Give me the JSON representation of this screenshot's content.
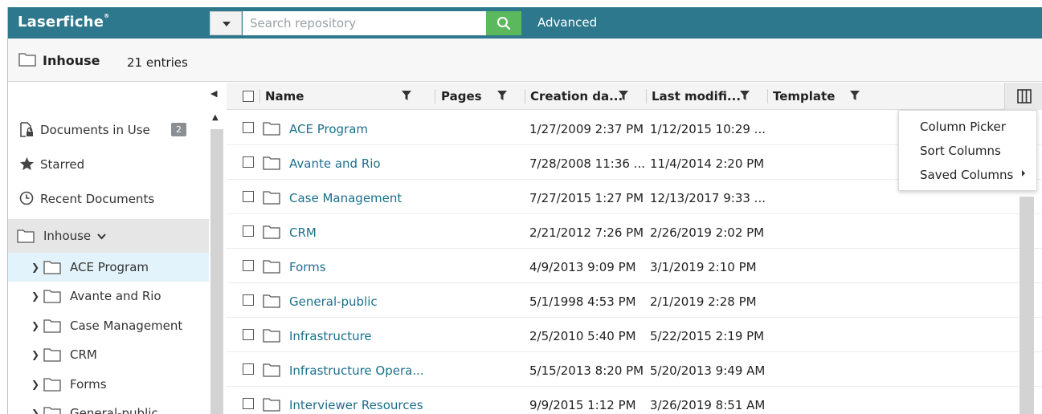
{
  "app": {
    "logo": "Laserfiche",
    "logo_mark": "®"
  },
  "search": {
    "placeholder": "Search repository",
    "advanced_label": "Advanced"
  },
  "header": {
    "folder_name": "Inhouse",
    "entry_count": "21 entries"
  },
  "nav": {
    "documents_in_use": "Documents in Use",
    "documents_in_use_count": "2",
    "starred": "Starred",
    "recent_documents": "Recent Documents",
    "current_folder": "Inhouse",
    "tree": [
      {
        "label": "ACE Program"
      },
      {
        "label": "Avante and Rio"
      },
      {
        "label": "Case Management"
      },
      {
        "label": "CRM"
      },
      {
        "label": "Forms"
      },
      {
        "label": "General-public"
      }
    ]
  },
  "grid": {
    "columns": {
      "name": "Name",
      "pages": "Pages",
      "creation": "Creation da...",
      "modified": "Last modifi...",
      "template": "Template"
    },
    "rows": [
      {
        "name": "ACE Program",
        "created": "1/27/2009 2:37 PM",
        "modified": "1/12/2015 10:29 ..."
      },
      {
        "name": "Avante and Rio",
        "created": "7/28/2008 11:36 ...",
        "modified": "11/4/2014 2:20 PM"
      },
      {
        "name": "Case Management",
        "created": "7/27/2015 1:27 PM",
        "modified": "12/13/2017 9:33 ..."
      },
      {
        "name": "CRM",
        "created": "2/21/2012 7:26 PM",
        "modified": "2/26/2019 2:02 PM"
      },
      {
        "name": "Forms",
        "created": "4/9/2013 9:09 PM",
        "modified": "3/1/2019 2:10 PM"
      },
      {
        "name": "General-public",
        "created": "5/1/1998 4:53 PM",
        "modified": "2/1/2019 2:28 PM"
      },
      {
        "name": "Infrastructure",
        "created": "2/5/2010 5:40 PM",
        "modified": "5/22/2015 2:19 PM"
      },
      {
        "name": "Infrastructure Opera...",
        "created": "5/15/2013 8:20 PM",
        "modified": "5/20/2013 9:49 AM"
      },
      {
        "name": "Interviewer Resources",
        "created": "9/9/2015 1:12 PM",
        "modified": "3/26/2019 8:51 AM"
      }
    ]
  },
  "column_menu": {
    "column_picker": "Column Picker",
    "sort_columns": "Sort Columns",
    "saved_columns": "Saved Columns"
  },
  "colors": {
    "topbar": "#2e788d",
    "search_button": "#5cb85c",
    "link": "#1b6f8c",
    "selected_tree": "#e3f3fb"
  }
}
